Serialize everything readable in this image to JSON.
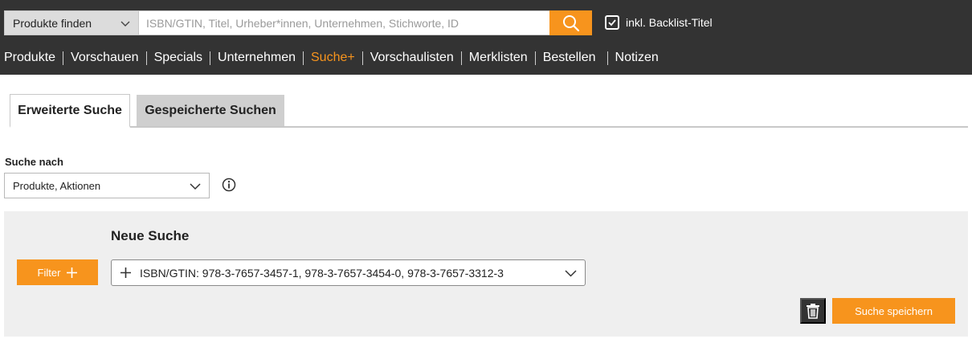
{
  "header": {
    "scope_select": {
      "value": "Produkte finden",
      "icon": "chevron-down-icon"
    },
    "search": {
      "placeholder": "ISBN/GTIN, Titel, Urheber*innen, Unternehmen, Stichworte, ID",
      "value": ""
    },
    "search_button_icon": "search-icon",
    "backlist": {
      "label": "inkl. Backlist-Titel",
      "checked": true
    }
  },
  "nav": {
    "items": [
      {
        "label": "Produkte",
        "active": false
      },
      {
        "label": "Vorschauen",
        "active": false
      },
      {
        "label": "Specials",
        "active": false
      },
      {
        "label": "Unternehmen",
        "active": false
      },
      {
        "label": "Suche+",
        "active": true
      },
      {
        "label": "Vorschaulisten",
        "active": false
      },
      {
        "label": "Merklisten",
        "active": false
      },
      {
        "label": "Bestellen",
        "active": false
      },
      {
        "label": "Notizen",
        "active": false
      }
    ]
  },
  "tabs": [
    {
      "label": "Erweiterte Suche",
      "active": true
    },
    {
      "label": "Gespeicherte Suchen",
      "active": false
    }
  ],
  "search_for": {
    "label": "Suche nach",
    "value": "Produkte, Aktionen"
  },
  "panel": {
    "title": "Neue Suche",
    "filter_button": "Filter",
    "criteria": "ISBN/GTIN: 978-3-7657-3457-1, 978-3-7657-3454-0, 978-3-7657-3312-3",
    "save_button": "Suche speichern"
  },
  "colors": {
    "accent": "#f7941d",
    "header_bg": "#333333",
    "panel_bg": "#efefef"
  }
}
